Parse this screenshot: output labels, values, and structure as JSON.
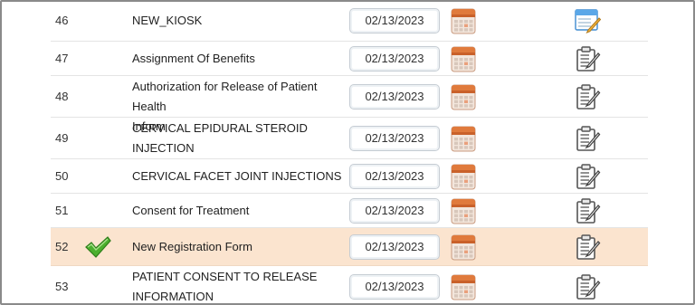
{
  "rows": [
    {
      "num": "46",
      "name_lines": [
        "NEW_KIOSK"
      ],
      "date": "02/13/2023",
      "checked": false,
      "icon": "edit-form-icon"
    },
    {
      "num": "47",
      "name_lines": [
        "Assignment Of Benefits"
      ],
      "date": "02/13/2023",
      "checked": false,
      "icon": "clipboard-pen-icon"
    },
    {
      "num": "48",
      "name_lines": [
        "Authorization for Release of Patient Health",
        "Inform"
      ],
      "date": "02/13/2023",
      "checked": false,
      "icon": "clipboard-pen-icon"
    },
    {
      "num": "49",
      "name_lines": [
        "CERVICAL EPIDURAL STEROID",
        "INJECTION"
      ],
      "date": "02/13/2023",
      "checked": false,
      "icon": "clipboard-pen-icon"
    },
    {
      "num": "50",
      "name_lines": [
        "CERVICAL FACET JOINT INJECTIONS"
      ],
      "date": "02/13/2023",
      "checked": false,
      "icon": "clipboard-pen-icon"
    },
    {
      "num": "51",
      "name_lines": [
        "Consent for Treatment"
      ],
      "date": "02/13/2023",
      "checked": false,
      "icon": "clipboard-pen-icon"
    },
    {
      "num": "52",
      "name_lines": [
        "New Registration Form"
      ],
      "date": "02/13/2023",
      "checked": true,
      "icon": "clipboard-pen-icon"
    },
    {
      "num": "53",
      "name_lines": [
        "PATIENT CONSENT TO RELEASE",
        "INFORMATION"
      ],
      "date": "02/13/2023",
      "checked": false,
      "icon": "clipboard-pen-icon"
    }
  ],
  "colors": {
    "highlight_row": "#fbe4cf",
    "check_green": "#4caf2e",
    "calendar_orange": "#e07a3c"
  }
}
